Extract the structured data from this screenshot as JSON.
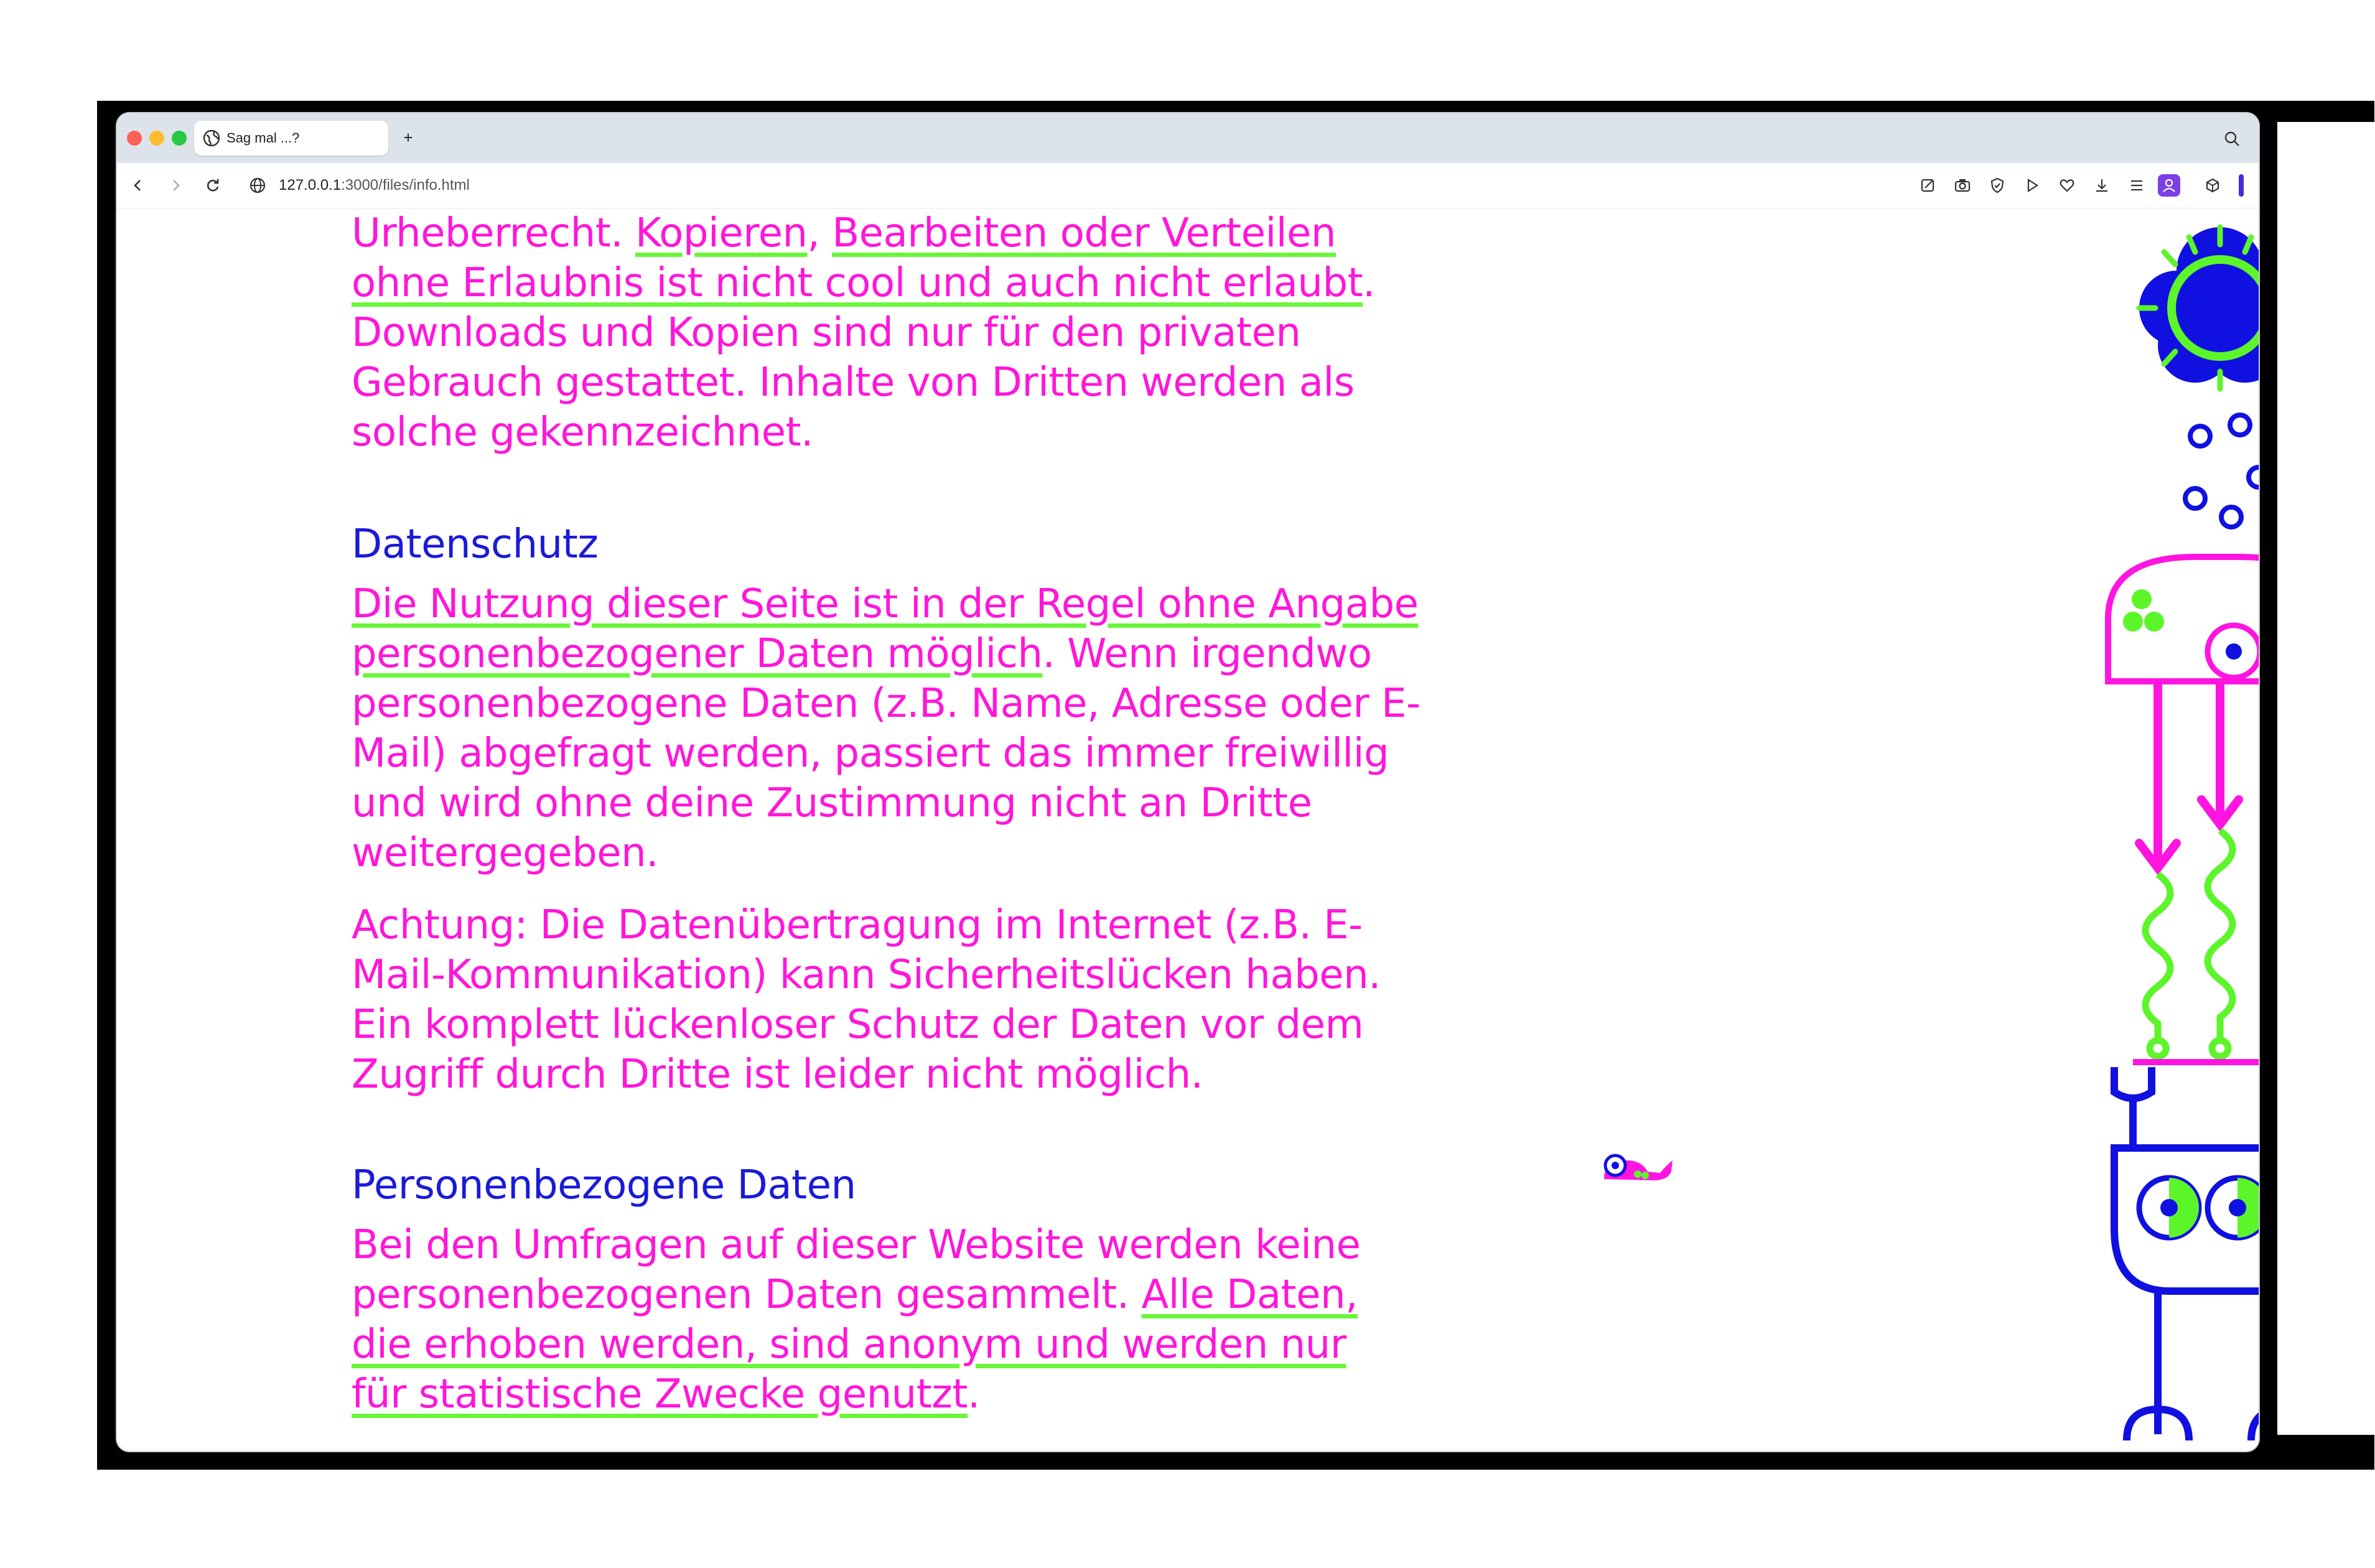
{
  "browser": {
    "tab_title": "Sag mal ...?",
    "new_tab_label": "+",
    "url_host": "127.0.0.1",
    "url_rest": ":3000/files/info.html"
  },
  "page": {
    "p1_line1_plain": "Urheberrecht. ",
    "p1_line1_link_a": "Kopieren",
    "p1_line1_sep": ", ",
    "p1_line1_link_b": "Bearbeiten oder Verteilen",
    "p1_line2_link": "ohne Erlaubnis ist nicht cool und auch nicht erlaubt",
    "p1_line2_end": ".",
    "p1_rest": "Downloads und Kopien sind nur für den privaten Gebrauch gestattet. Inhalte von Dritten werden als solche gekennzeichnet.",
    "h_datenschutz": "Datenschutz",
    "p2_link": "Die Nutzung dieser Seite ist in der Regel ohne Angabe personenbezogener Daten möglich",
    "p2_rest": ". Wenn irgendwo personenbezogene Daten (z.B. Name, Adresse oder E-Mail) abgefragt werden, passiert das immer freiwillig und wird ohne deine Zustimmung nicht an Dritte weitergegeben.",
    "p3": "Achtung: Die Datenübertragung im Internet (z.B. E-Mail-Kommunikation) kann Sicherheitslücken haben. Ein komplett lückenloser Schutz der Daten vor dem Zugriff durch Dritte ist leider nicht möglich.",
    "h_personen": "Personenbezogene Daten",
    "p4_plain": "Bei den Umfragen auf dieser Website werden keine personenbezogenen Daten gesammelt. ",
    "p4_link": "Alle Daten, die erhoben werden, sind anonym und werden nur für statistische Zwecke genutzt",
    "p4_end": "."
  },
  "colors": {
    "text": "#ff16d9",
    "heading": "#1a1ad8",
    "underline": "#6af53a",
    "art_blue": "#1010e0",
    "art_green": "#5cf52a",
    "art_magenta": "#ff14e0"
  },
  "icons": [
    "globe-icon",
    "plus-icon",
    "search-icon",
    "back-icon",
    "forward-icon",
    "reload-icon",
    "site-info-icon",
    "edit-icon",
    "camera-icon",
    "shield-icon",
    "play-icon",
    "heart-icon",
    "download-icon",
    "menu-icon",
    "profile-icon",
    "extension-icon"
  ]
}
